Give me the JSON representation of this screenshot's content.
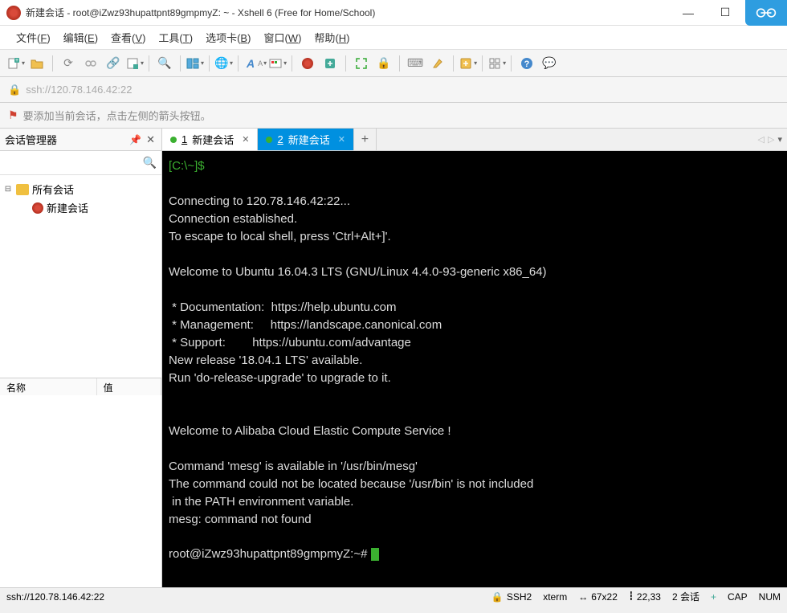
{
  "titlebar": {
    "title": "新建会话 - root@iZwz93hupattpnt89gmpmyZ: ~ - Xshell 6 (Free for Home/School)"
  },
  "menubar": {
    "items": [
      {
        "label": "文件",
        "key": "F"
      },
      {
        "label": "编辑",
        "key": "E"
      },
      {
        "label": "查看",
        "key": "V"
      },
      {
        "label": "工具",
        "key": "T"
      },
      {
        "label": "选项卡",
        "key": "B"
      },
      {
        "label": "窗口",
        "key": "W"
      },
      {
        "label": "帮助",
        "key": "H"
      }
    ]
  },
  "addressbar": {
    "url": "ssh://120.78.146.42:22"
  },
  "hintbar": {
    "text": "要添加当前会话，点击左侧的箭头按钮。"
  },
  "sidebar": {
    "title": "会话管理器",
    "root": "所有会话",
    "session": "新建会话",
    "col_name": "名称",
    "col_value": "值"
  },
  "tabs": [
    {
      "num": "1",
      "label": "新建会话",
      "active": false
    },
    {
      "num": "2",
      "label": "新建会话",
      "active": true
    }
  ],
  "terminal": {
    "prompt": "[C:\\~]$ ",
    "lines": [
      "",
      "Connecting to 120.78.146.42:22...",
      "Connection established.",
      "To escape to local shell, press 'Ctrl+Alt+]'.",
      "",
      "Welcome to Ubuntu 16.04.3 LTS (GNU/Linux 4.4.0-93-generic x86_64)",
      "",
      " * Documentation:  https://help.ubuntu.com",
      " * Management:     https://landscape.canonical.com",
      " * Support:        https://ubuntu.com/advantage",
      "New release '18.04.1 LTS' available.",
      "Run 'do-release-upgrade' to upgrade to it.",
      "",
      "",
      "Welcome to Alibaba Cloud Elastic Compute Service !",
      "",
      "Command 'mesg' is available in '/usr/bin/mesg'",
      "The command could not be located because '/usr/bin' is not included",
      " in the PATH environment variable.",
      "mesg: command not found"
    ],
    "shell_prompt": "root@iZwz93hupattpnt89gmpmyZ:~# "
  },
  "statusbar": {
    "addr": "ssh://120.78.146.42:22",
    "proto": "SSH2",
    "term": "xterm",
    "size": "67x22",
    "pos": "22,33",
    "sessions": "2 会话",
    "cap": "CAP",
    "num": "NUM"
  },
  "icons": {
    "new": "new",
    "open": "open",
    "save": "save",
    "sessions": "sessions",
    "link": "link",
    "props": "props",
    "copy": "copy",
    "paste": "paste",
    "search": "search",
    "panels": "panels",
    "globe": "globe",
    "font": "font",
    "color": "color",
    "xshell": "xshell",
    "xftp": "xftp",
    "fullscreen": "fullscreen",
    "lock": "lock",
    "keyboard": "keyboard",
    "highlight": "highlight",
    "add": "add",
    "layout": "layout",
    "help": "help",
    "chat": "chat"
  }
}
